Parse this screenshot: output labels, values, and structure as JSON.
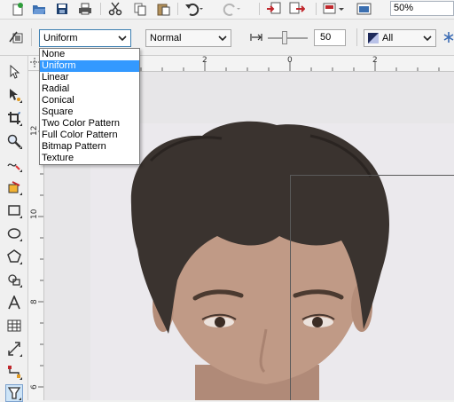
{
  "toolbar": {
    "zoom_value": "50%"
  },
  "property_bar": {
    "fill_type_value": "Uniform",
    "merge_mode_value": "Normal",
    "transparency_value": "50",
    "target_value": "All"
  },
  "fill_type_options": [
    "None",
    "Uniform",
    "Linear",
    "Radial",
    "Conical",
    "Square",
    "Two Color Pattern",
    "Full Color Pattern",
    "Bitmap Pattern",
    "Texture"
  ],
  "selected_option": "Uniform",
  "rulers": {
    "horizontal_labels": [
      "2",
      "0",
      "2"
    ],
    "vertical_labels": [
      "12",
      "10",
      "8",
      "6"
    ]
  },
  "colors": {
    "selection_highlight": "#3399ff",
    "canvas_bg": "#e7e6e8",
    "photo_bg": "#eae8ec"
  },
  "icons": {
    "toolbar": [
      "new-document-icon",
      "open-icon",
      "save-icon",
      "print-icon",
      "cut-icon",
      "copy-icon",
      "paste-icon",
      "undo-icon",
      "redo-icon",
      "import-icon",
      "export-icon",
      "launcher-icon",
      "full-screen-icon"
    ],
    "toolbox": [
      "pick-tool-icon",
      "shape-tool-icon",
      "crop-tool-icon",
      "zoom-tool-icon",
      "freehand-tool-icon",
      "smart-fill-icon",
      "rectangle-tool-icon",
      "ellipse-tool-icon",
      "polygon-tool-icon",
      "basic-shapes-icon",
      "text-tool-icon",
      "table-tool-icon",
      "dimension-tool-icon",
      "connector-tool-icon",
      "transparency-tool-icon"
    ]
  }
}
